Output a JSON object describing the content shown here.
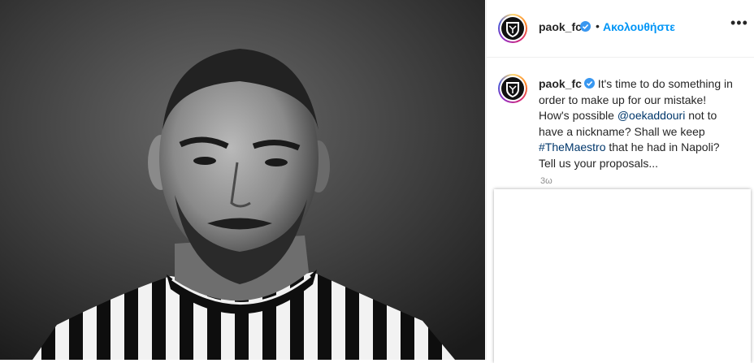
{
  "photo": {
    "alt_icon": "player-portrait"
  },
  "header": {
    "username": "paok_fc",
    "separator": "•",
    "follow_label": "Ακολουθήστε",
    "more_label": "•••"
  },
  "caption": {
    "username": "paok_fc",
    "text_1": " It's time to do something in order to make up for our mistake! How's possible ",
    "mention": "@oekaddouri",
    "text_2": " not to have a nickname? Shall we keep ",
    "hashtag": "#TheMaestro",
    "text_3": " that he had in Napoli? Tell us your proposals...",
    "time": "3ω"
  },
  "colors": {
    "follow": "#0095f6",
    "link": "#00376b",
    "verified": "#3897f0"
  }
}
